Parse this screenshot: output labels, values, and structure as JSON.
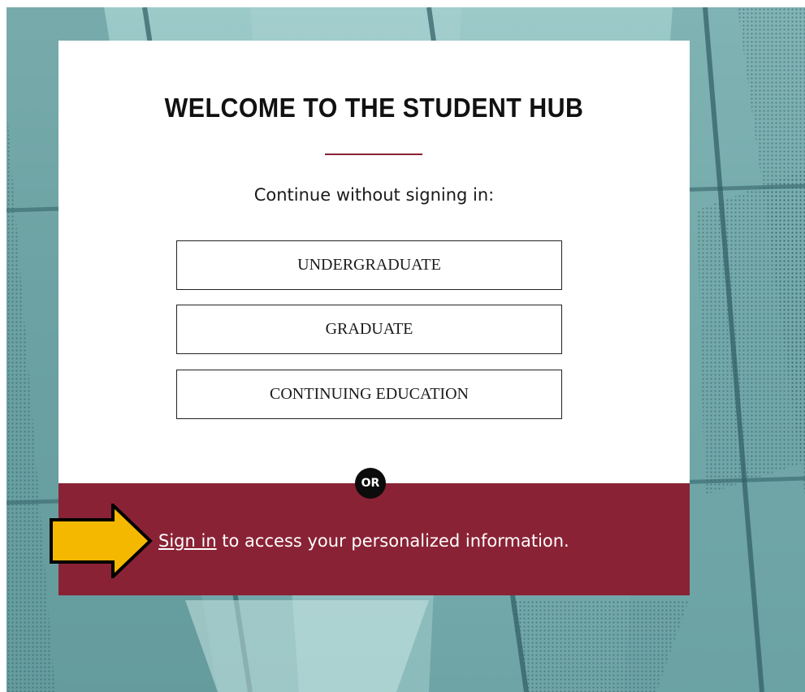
{
  "page": {
    "title": "WELCOME TO THE STUDENT HUB",
    "subtitle": "Continue without signing in:",
    "choices": [
      {
        "label": "UNDERGRADUATE"
      },
      {
        "label": "GRADUATE"
      },
      {
        "label": "CONTINUING EDUCATION"
      }
    ],
    "or_label": "OR",
    "sign_in": {
      "link_text": "Sign in",
      "rest_text": " to access your personalized information."
    }
  },
  "annotation": {
    "icon": "arrow-right-icon",
    "color": "#f5b800"
  },
  "colors": {
    "brand": "#8a2235",
    "background": "#7fb3b4"
  }
}
